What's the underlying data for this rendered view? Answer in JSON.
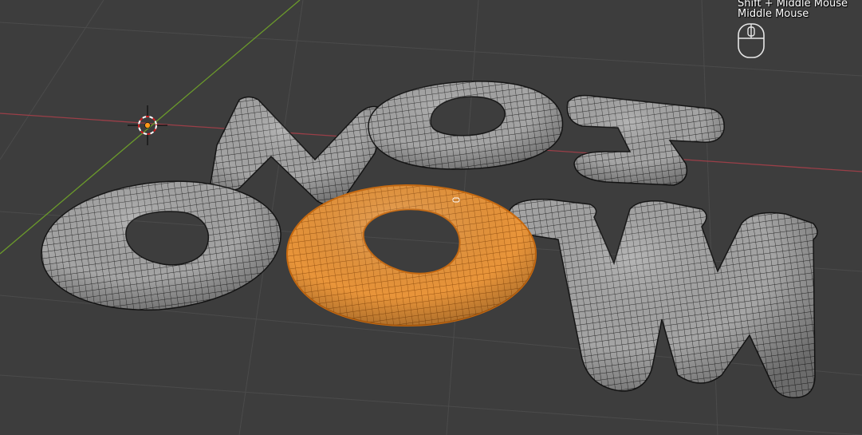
{
  "viewport": {
    "background_color": "#3d3d3d",
    "grid_color": "#4a4a4a",
    "x_axis_color": "#a0404a",
    "y_axis_color": "#6a9a2a"
  },
  "navigation_hint": {
    "line1": "Shift + Middle Mouse",
    "line2": "Middle Mouse",
    "icon": "mouse-icon"
  },
  "objects": {
    "unselected_color": "#a3a3a3",
    "selected_color": "#e8963c",
    "wire_color": "#1e1e1e",
    "selected_wire_color": "#8a4a0a"
  },
  "cursor_3d": {
    "icon": "3d-cursor-icon",
    "origin_color": "#ff9a1a"
  }
}
